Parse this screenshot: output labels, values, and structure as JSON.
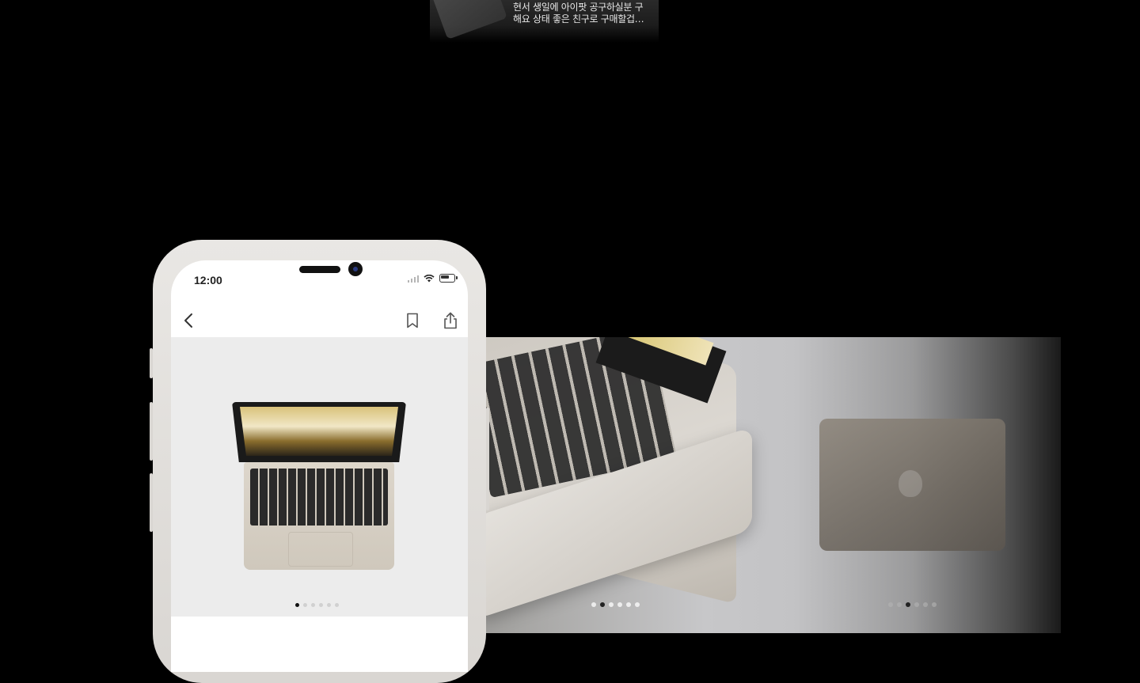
{
  "review": {
    "line1": "현서 생일에 아이팟 공구하실분 구",
    "line2": "해요 상태 좋은 친구로 구매할겁…"
  },
  "status_bar": {
    "time": "12:00"
  },
  "icons": {
    "back": "chevron-left-icon",
    "bookmark": "bookmark-icon",
    "share": "share-icon",
    "signal": "cellular-signal-icon",
    "wifi": "wifi-icon",
    "battery": "battery-icon"
  },
  "carousels": {
    "phone": {
      "total": 6,
      "active": 0
    },
    "middle": {
      "total": 6,
      "active": 1
    },
    "right": {
      "total": 6,
      "active": 2
    }
  },
  "colors": {
    "background": "#000000",
    "phone_frame": "#e9e7e4",
    "product_bg": "#ececec"
  }
}
